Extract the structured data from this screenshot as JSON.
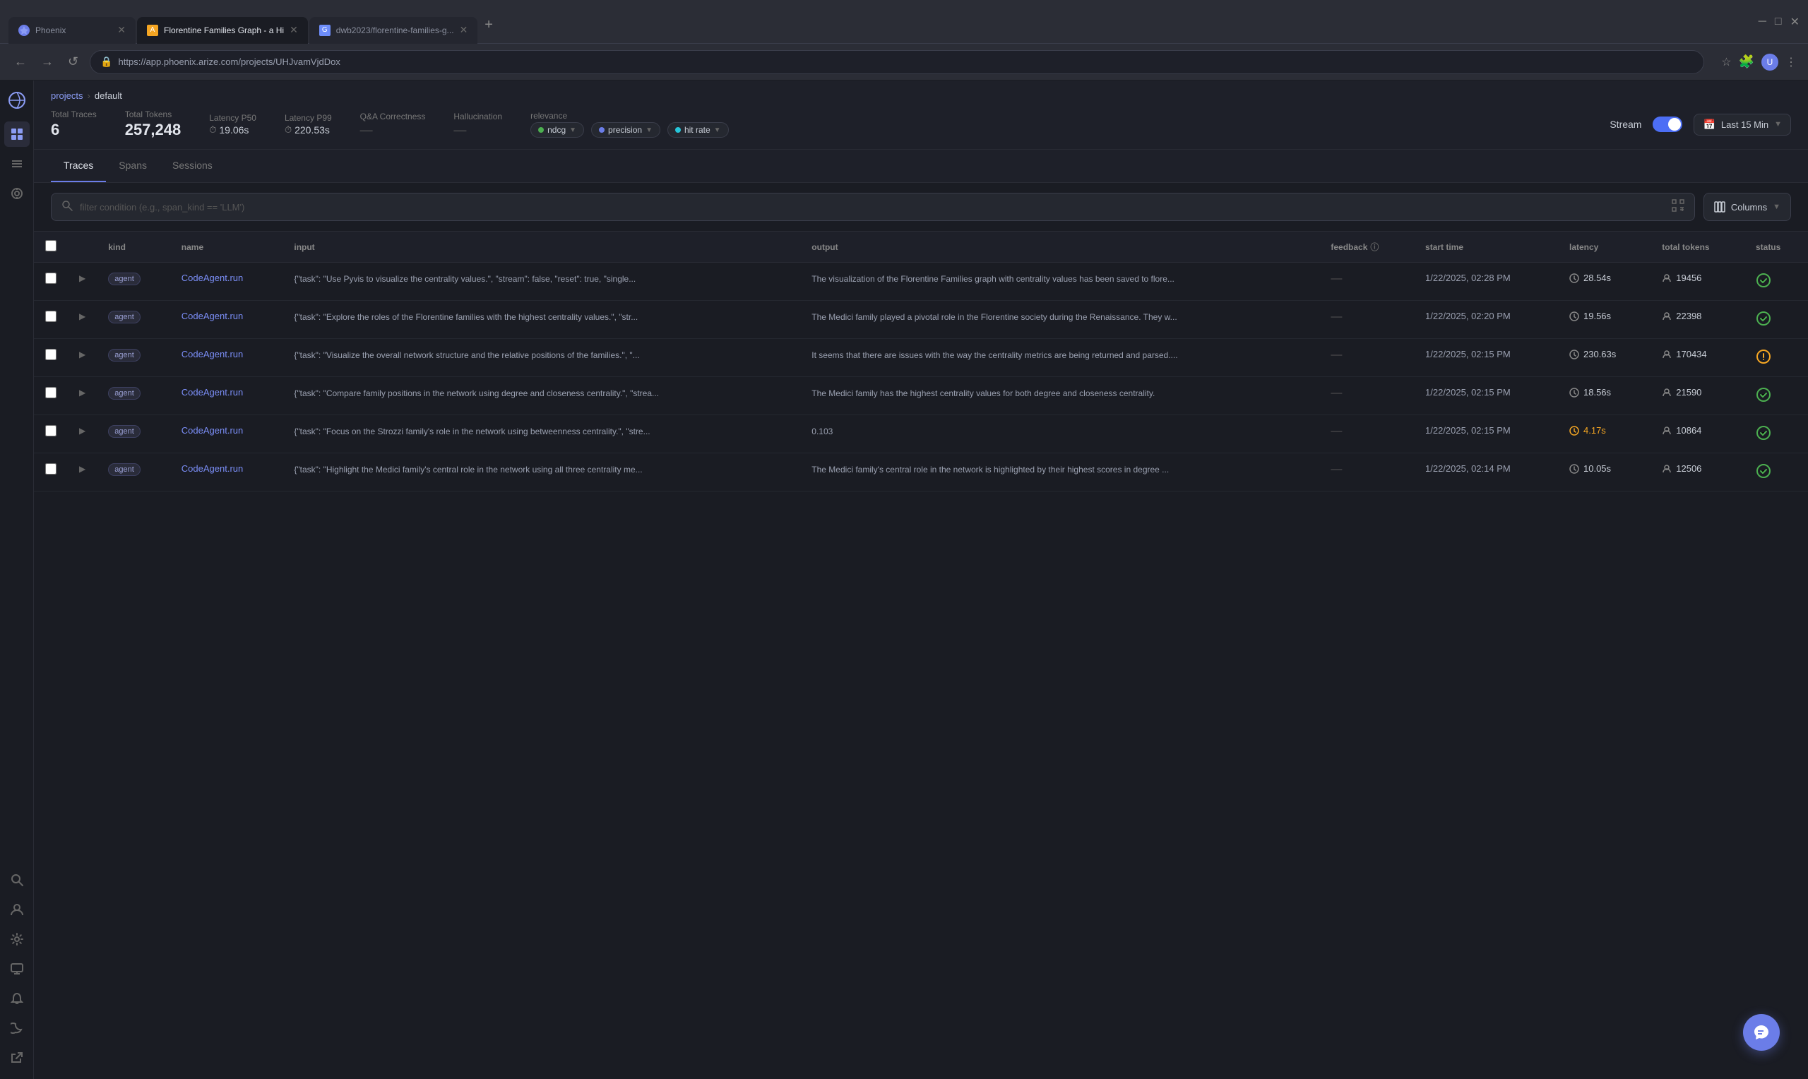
{
  "browser": {
    "tabs": [
      {
        "id": "t1",
        "label": "Phoenix",
        "favicon": "phoenix",
        "active": false,
        "closeable": true
      },
      {
        "id": "t2",
        "label": "Florentine Families Graph - a Hi",
        "favicon": "page",
        "active": true,
        "closeable": true
      },
      {
        "id": "t3",
        "label": "dwb2023/florentine-families-g...",
        "favicon": "git",
        "active": false,
        "closeable": true
      }
    ],
    "url": "https://app.phoenix.arize.com/projects/UHJvamVjdDox",
    "nav": {
      "back": "←",
      "forward": "→",
      "reload": "↺"
    }
  },
  "breadcrumb": {
    "projects": "projects",
    "separator": "›",
    "current": "default"
  },
  "metrics": {
    "totalTraces": {
      "label": "Total Traces",
      "value": "6"
    },
    "totalTokens": {
      "label": "Total Tokens",
      "value": "257,248"
    },
    "latencyP50": {
      "label": "Latency P50",
      "value": "19.06s"
    },
    "latencyP99": {
      "label": "Latency P99",
      "value": "220.53s"
    },
    "qaCorrectness": {
      "label": "Q&A Correctness",
      "value": "—"
    },
    "hallucination": {
      "label": "Hallucination",
      "value": "—"
    },
    "relevance": {
      "label": "relevance",
      "badges": [
        {
          "color": "#4caf50",
          "label": "ndcg",
          "arrow": "▼"
        },
        {
          "color": "#6b7de8",
          "label": "precision",
          "arrow": "▼"
        },
        {
          "color": "#26c6da",
          "label": "hit rate",
          "arrow": "▼"
        }
      ]
    }
  },
  "stream": {
    "label": "Stream",
    "enabled": true
  },
  "datepicker": {
    "label": "Last 15 Min",
    "arrow": "▼"
  },
  "tabs": [
    {
      "id": "traces",
      "label": "Traces",
      "active": true
    },
    {
      "id": "spans",
      "label": "Spans",
      "active": false
    },
    {
      "id": "sessions",
      "label": "Sessions",
      "active": false
    }
  ],
  "filter": {
    "placeholder": "filter condition (e.g., span_kind == 'LLM')",
    "columnsLabel": "Columns",
    "columnsArrow": "▼"
  },
  "table": {
    "headers": [
      {
        "id": "checkbox",
        "label": ""
      },
      {
        "id": "expand",
        "label": ""
      },
      {
        "id": "kind",
        "label": "kind"
      },
      {
        "id": "name",
        "label": "name"
      },
      {
        "id": "input",
        "label": "input"
      },
      {
        "id": "output",
        "label": "output"
      },
      {
        "id": "feedback",
        "label": "feedback"
      },
      {
        "id": "start_time",
        "label": "start time"
      },
      {
        "id": "latency",
        "label": "latency"
      },
      {
        "id": "total_tokens",
        "label": "total tokens"
      },
      {
        "id": "status",
        "label": "status"
      }
    ],
    "rows": [
      {
        "kind": "agent",
        "name": "CodeAgent.run",
        "input": "{\"task\": \"Use Pyvis to visualize the centrality values.\", \"stream\": false, \"reset\": true, \"single...",
        "output": "The visualization of the Florentine Families graph with centrality values has been saved to flore...",
        "feedback": "—",
        "startTime": "1/22/2025, 02:28 PM",
        "latency": "28.54s",
        "latencyWarn": false,
        "totalTokens": "19456",
        "status": "ok"
      },
      {
        "kind": "agent",
        "name": "CodeAgent.run",
        "input": "{\"task\": \"Explore the roles of the Florentine families with the highest centrality values.\", \"str...",
        "output": "The Medici family played a pivotal role in the Florentine society during the Renaissance. They w...",
        "feedback": "—",
        "startTime": "1/22/2025, 02:20 PM",
        "latency": "19.56s",
        "latencyWarn": false,
        "totalTokens": "22398",
        "status": "ok"
      },
      {
        "kind": "agent",
        "name": "CodeAgent.run",
        "input": "{\"task\": \"Visualize the overall network structure and the relative positions of the families.\", \"...",
        "output": "It seems that there are issues with the way the centrality metrics are being returned and parsed....",
        "feedback": "—",
        "startTime": "1/22/2025, 02:15 PM",
        "latency": "230.63s",
        "latencyWarn": false,
        "totalTokens": "170434",
        "status": "warn"
      },
      {
        "kind": "agent",
        "name": "CodeAgent.run",
        "input": "{\"task\": \"Compare family positions in the network using degree and closeness centrality.\", \"strea...",
        "output": "The Medici family has the highest centrality values for both degree and closeness centrality.",
        "feedback": "—",
        "startTime": "1/22/2025, 02:15 PM",
        "latency": "18.56s",
        "latencyWarn": false,
        "totalTokens": "21590",
        "status": "ok"
      },
      {
        "kind": "agent",
        "name": "CodeAgent.run",
        "input": "{\"task\": \"Focus on the Strozzi family's role in the network using betweenness centrality.\", \"stre...",
        "output": "0.103",
        "feedback": "—",
        "startTime": "1/22/2025, 02:15 PM",
        "latency": "4.17s",
        "latencyWarn": true,
        "totalTokens": "10864",
        "status": "ok"
      },
      {
        "kind": "agent",
        "name": "CodeAgent.run",
        "input": "{\"task\": \"Highlight the Medici family's central role in the network using all three centrality me...",
        "output": "The Medici family's central role in the network is highlighted by their highest scores in degree ...",
        "feedback": "—",
        "startTime": "1/22/2025, 02:14 PM",
        "latency": "10.05s",
        "latencyWarn": false,
        "totalTokens": "12506",
        "status": "ok"
      }
    ]
  },
  "sidebar": {
    "icons": [
      {
        "id": "search",
        "symbol": "🔍",
        "active": false
      },
      {
        "id": "user",
        "symbol": "👤",
        "active": false
      },
      {
        "id": "settings",
        "symbol": "⚙",
        "active": false
      },
      {
        "id": "monitor",
        "symbol": "🖥",
        "active": false
      },
      {
        "id": "alert",
        "symbol": "🔔",
        "active": false
      },
      {
        "id": "moon",
        "symbol": "🌙",
        "active": false
      },
      {
        "id": "export",
        "symbol": "↗",
        "active": false
      }
    ]
  },
  "chat_button": {
    "symbol": "💬"
  }
}
